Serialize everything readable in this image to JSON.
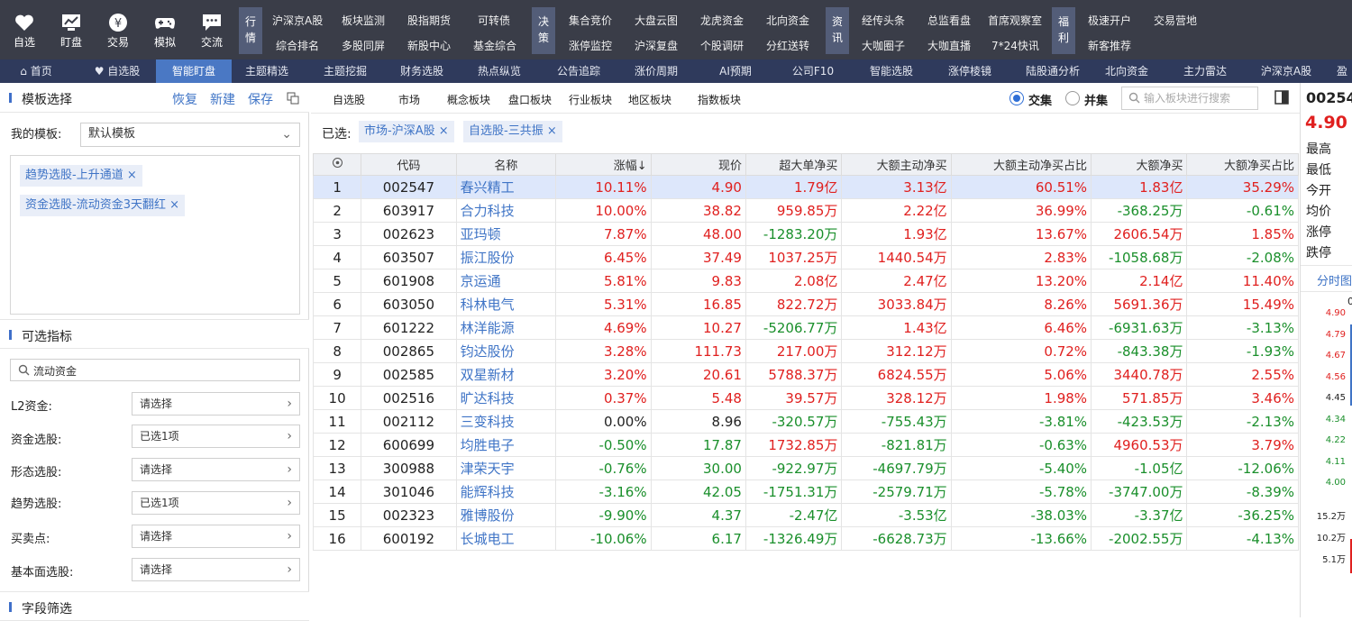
{
  "top_nav": {
    "big_buttons": [
      {
        "label": "自选",
        "icon": "heart-icon"
      },
      {
        "label": "盯盘",
        "icon": "chart-monitor-icon"
      },
      {
        "label": "交易",
        "icon": "yen-coin-icon"
      },
      {
        "label": "模拟",
        "icon": "gamepad-icon"
      },
      {
        "label": "交流",
        "icon": "chat-bubble-icon"
      }
    ],
    "groups": [
      {
        "title": [
          "行",
          "情"
        ],
        "links": [
          [
            "沪深京A股",
            "板块监测",
            "股指期货",
            "可转债"
          ],
          [
            "综合排名",
            "多股同屏",
            "新股中心",
            "基金综合"
          ]
        ]
      },
      {
        "title": [
          "决",
          "策"
        ],
        "links": [
          [
            "集合竞价",
            "大盘云图",
            "龙虎资金",
            "北向资金"
          ],
          [
            "涨停监控",
            "沪深复盘",
            "个股调研",
            "分红送转"
          ]
        ]
      },
      {
        "title": [
          "资",
          "讯"
        ],
        "links": [
          [
            "经传头条",
            "总监看盘",
            "首席观察室"
          ],
          [
            "大咖圈子",
            "大咖直播",
            "7*24快讯"
          ]
        ]
      },
      {
        "title": [
          "福",
          "利"
        ],
        "links": [
          [
            "极速开户",
            "交易营地"
          ],
          [
            "新客推荐"
          ]
        ]
      }
    ]
  },
  "tabs": [
    {
      "label": "首页",
      "icon": "home-icon"
    },
    {
      "label": "自选股",
      "icon": "heart-icon"
    },
    {
      "label": "智能盯盘",
      "active": true
    },
    {
      "label": "主题精选"
    },
    {
      "label": "主题挖掘"
    },
    {
      "label": "财务选股"
    },
    {
      "label": "热点纵览"
    },
    {
      "label": "公告追踪"
    },
    {
      "label": "涨价周期"
    },
    {
      "label": "AI预期"
    },
    {
      "label": "公司F10"
    },
    {
      "label": "智能选股"
    },
    {
      "label": "涨停棱镜"
    },
    {
      "label": "陆股通分析"
    },
    {
      "label": "北向资金"
    },
    {
      "label": "主力雷达"
    },
    {
      "label": "沪深京A股"
    },
    {
      "label": "盈"
    }
  ],
  "left": {
    "template_section": {
      "title": "模板选择",
      "restore": "恢复",
      "new": "新建",
      "save": "保存"
    },
    "my_template_label": "我的模板:",
    "my_template_value": "默认模板",
    "selected_chips": [
      "趋势选股-上升通道",
      "资金选股-流动资金3天翻红"
    ],
    "indicator_section": "可选指标",
    "indicator_search": "流动资金",
    "filters": [
      {
        "label": "L2资金:",
        "value": "请选择"
      },
      {
        "label": "资金选股:",
        "value": "已选1项"
      },
      {
        "label": "形态选股:",
        "value": "请选择"
      },
      {
        "label": "趋势选股:",
        "value": "已选1项"
      },
      {
        "label": "买卖点:",
        "value": "请选择"
      },
      {
        "label": "基本面选股:",
        "value": "请选择"
      }
    ],
    "field_section": "字段筛选"
  },
  "main": {
    "pool_tabs": [
      "自选股",
      "市场",
      "概念板块",
      "盘口板块",
      "行业板块",
      "地区板块",
      "指数板块"
    ],
    "mode_intersection": "交集",
    "mode_union": "并集",
    "search_placeholder": "输入板块进行搜索",
    "selected_label": "已选:",
    "selected_tags": [
      "市场-沪深A股",
      "自选股-三共振"
    ],
    "table": {
      "headers": [
        "",
        "代码",
        "名称",
        "涨幅↓",
        "现价",
        "超大单净买",
        "大额主动净买",
        "大额主动净买占比",
        "大额净买",
        "大额净买占比"
      ],
      "rows": [
        [
          "1",
          "002547",
          "春兴精工",
          "10.11%",
          "4.90",
          "1.79亿",
          "3.13亿",
          "60.51%",
          "1.83亿",
          "35.29%"
        ],
        [
          "2",
          "603917",
          "合力科技",
          "10.00%",
          "38.82",
          "959.85万",
          "2.22亿",
          "36.99%",
          "-368.25万",
          "-0.61%"
        ],
        [
          "3",
          "002623",
          "亚玛顿",
          "7.87%",
          "48.00",
          "-1283.20万",
          "1.93亿",
          "13.67%",
          "2606.54万",
          "1.85%"
        ],
        [
          "4",
          "603507",
          "振江股份",
          "6.45%",
          "37.49",
          "1037.25万",
          "1440.54万",
          "2.83%",
          "-1058.68万",
          "-2.08%"
        ],
        [
          "5",
          "601908",
          "京运通",
          "5.81%",
          "9.83",
          "2.08亿",
          "2.47亿",
          "13.20%",
          "2.14亿",
          "11.40%"
        ],
        [
          "6",
          "603050",
          "科林电气",
          "5.31%",
          "16.85",
          "822.72万",
          "3033.84万",
          "8.26%",
          "5691.36万",
          "15.49%"
        ],
        [
          "7",
          "601222",
          "林洋能源",
          "4.69%",
          "10.27",
          "-5206.77万",
          "1.43亿",
          "6.46%",
          "-6931.63万",
          "-3.13%"
        ],
        [
          "8",
          "002865",
          "钧达股份",
          "3.28%",
          "111.73",
          "217.00万",
          "312.12万",
          "0.72%",
          "-843.38万",
          "-1.93%"
        ],
        [
          "9",
          "002585",
          "双星新材",
          "3.20%",
          "20.61",
          "5788.37万",
          "6824.55万",
          "5.06%",
          "3440.78万",
          "2.55%"
        ],
        [
          "10",
          "002516",
          "旷达科技",
          "0.37%",
          "5.48",
          "39.57万",
          "328.12万",
          "1.98%",
          "571.85万",
          "3.46%"
        ],
        [
          "11",
          "002112",
          "三变科技",
          "0.00%",
          "8.96",
          "-320.57万",
          "-755.43万",
          "-3.81%",
          "-423.53万",
          "-2.13%"
        ],
        [
          "12",
          "600699",
          "均胜电子",
          "-0.50%",
          "17.87",
          "1732.85万",
          "-821.81万",
          "-0.63%",
          "4960.53万",
          "3.79%"
        ],
        [
          "13",
          "300988",
          "津荣天宇",
          "-0.76%",
          "30.00",
          "-922.97万",
          "-4697.79万",
          "-5.40%",
          "-1.05亿",
          "-12.06%"
        ],
        [
          "14",
          "301046",
          "能辉科技",
          "-3.16%",
          "42.05",
          "-1751.31万",
          "-2579.71万",
          "-5.78%",
          "-3747.00万",
          "-8.39%"
        ],
        [
          "15",
          "002323",
          "雅博股份",
          "-9.90%",
          "4.37",
          "-2.47亿",
          "-3.53亿",
          "-38.03%",
          "-3.37亿",
          "-36.25%"
        ],
        [
          "16",
          "600192",
          "长城电工",
          "-10.06%",
          "6.17",
          "-1326.49万",
          "-6628.73万",
          "-13.66%",
          "-2002.55万",
          "-4.13%"
        ]
      ],
      "highlighted_row": 0
    }
  },
  "right_panel": {
    "code": "00254",
    "price": "4.90",
    "fields": [
      "最高",
      "最低",
      "今开",
      "均价",
      "涨停",
      "跌停"
    ],
    "tab": "分时图",
    "axis_top": "0",
    "price_ticks": [
      "4.90",
      "4.79",
      "4.67",
      "4.56",
      "4.45",
      "4.34",
      "4.22",
      "4.11",
      "4.00"
    ],
    "volume_ticks": [
      "15.2万",
      "10.2万",
      "5.1万"
    ]
  },
  "colors": {
    "up": "#e0201f",
    "down": "#1a8f2b",
    "accent": "#3f74c6",
    "topbar": "#3a3d48",
    "tabbar": "#2f3a5c",
    "active_tab": "#4a78c4",
    "highlight_row": "#dde7fb"
  }
}
